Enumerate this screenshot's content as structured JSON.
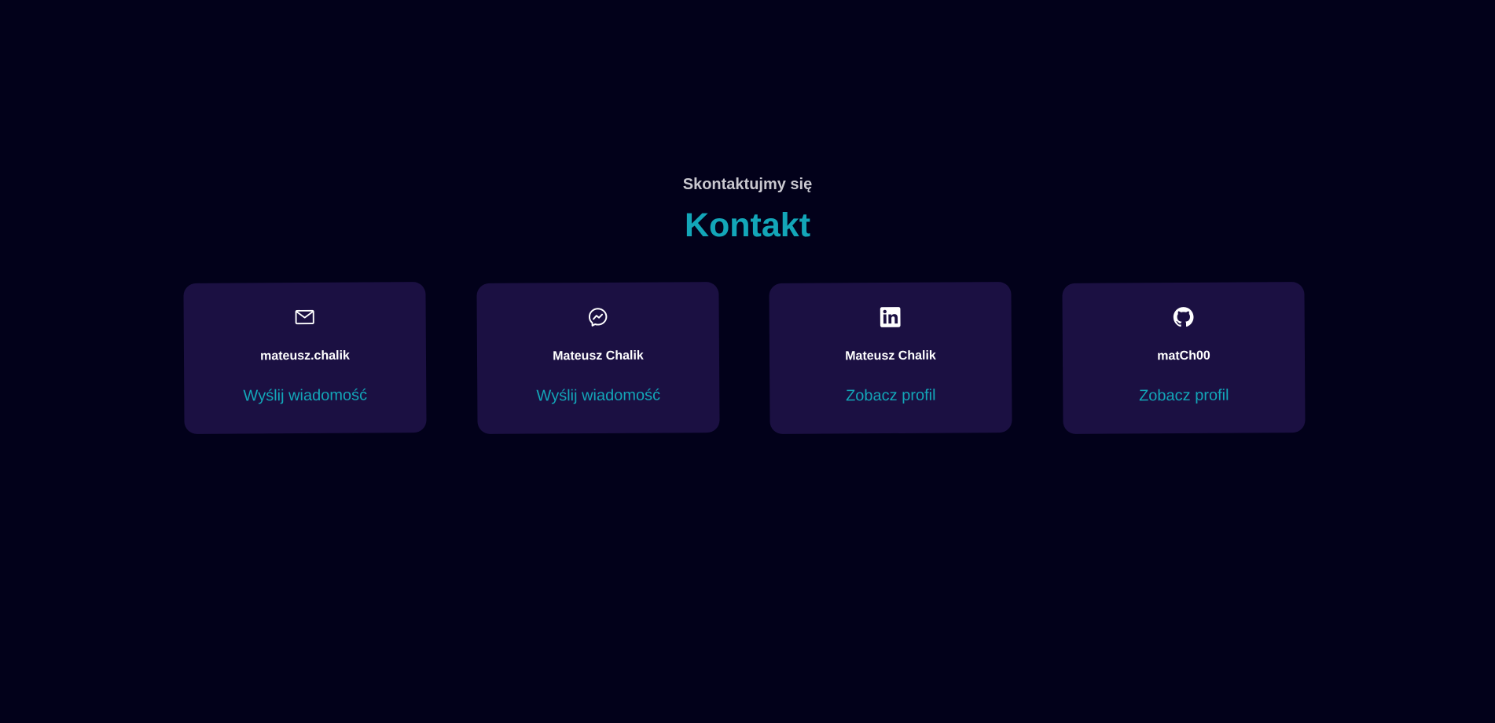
{
  "header": {
    "subtitle": "Skontaktujmy się",
    "title": "Kontakt"
  },
  "contacts": [
    {
      "icon": "mail-icon",
      "name": "mateusz.chalik",
      "link_label": "Wyślij wiadomość"
    },
    {
      "icon": "messenger-icon",
      "name": "Mateusz Chalik",
      "link_label": "Wyślij wiadomość"
    },
    {
      "icon": "linkedin-icon",
      "name": "Mateusz Chalik",
      "link_label": "Zobacz profil"
    },
    {
      "icon": "github-icon",
      "name": "matCh00",
      "link_label": "Zobacz profil"
    }
  ],
  "colors": {
    "background": "#02011a",
    "card": "#1b1042",
    "accent": "#13a6b8",
    "subtitle": "#c9c8cf",
    "text": "#ffffff"
  }
}
